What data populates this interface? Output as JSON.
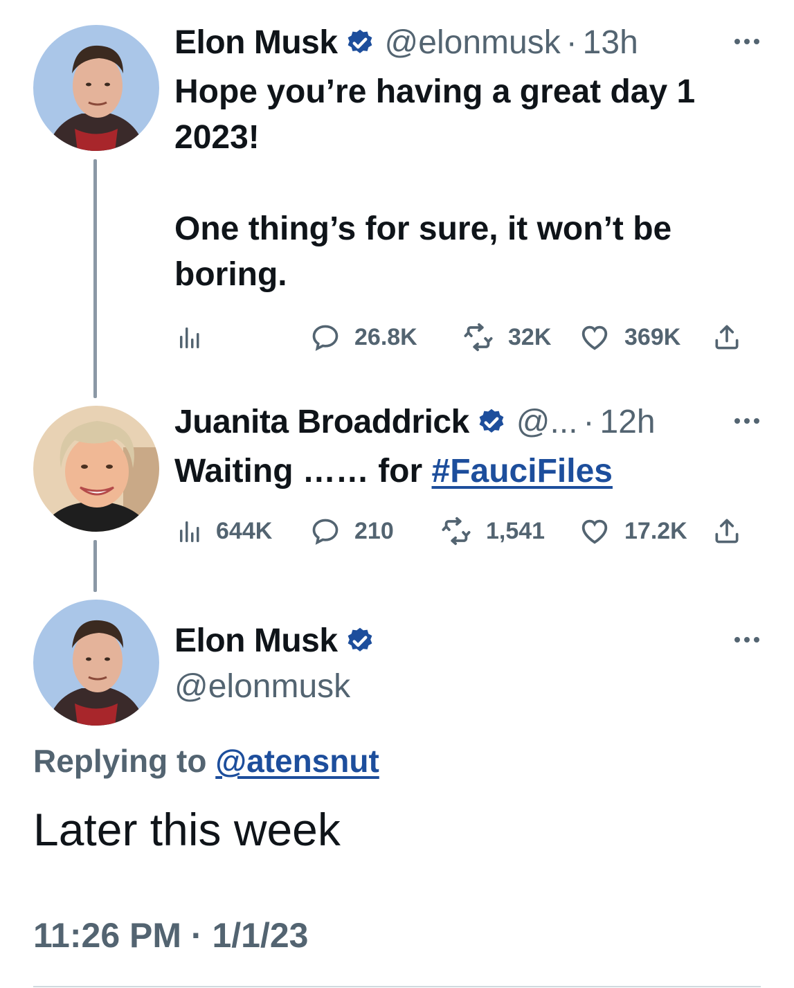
{
  "tweets": [
    {
      "name": "Elon Musk",
      "handle": "@elonmusk",
      "separator": "·",
      "time": "13h",
      "text": "Hope you’re having a great day 1\n2023!\n\nOne thing’s for sure, it won’t be\nboring.",
      "stats": {
        "views": "",
        "replies": "26.8K",
        "retweets": "32K",
        "likes": "369K"
      },
      "avatar_icon": "avatar-elon-musk"
    },
    {
      "name": "Juanita Broaddrick",
      "handle": "@...",
      "separator": "·",
      "time": "12h",
      "text_prefix": "Waiting …… for ",
      "hashtag": "#FauciFiles",
      "stats": {
        "views": "644K",
        "replies": "210",
        "retweets": "1,541",
        "likes": "17.2K"
      },
      "avatar_icon": "avatar-juanita-broaddrick"
    }
  ],
  "main_tweet": {
    "name": "Elon Musk",
    "handle": "@elonmusk",
    "replying_label": "Replying to ",
    "replying_to": "@atensnut",
    "text": "Later this week",
    "timestamp": "11:26 PM · 1/1/23"
  },
  "colors": {
    "verified": "#1d4e9c",
    "link": "#1d4e9c",
    "secondary_text": "#536471",
    "thread_line": "#8b98a5"
  },
  "icons": [
    "verified-badge-icon",
    "more-icon",
    "views-icon",
    "reply-icon",
    "retweet-icon",
    "like-icon",
    "share-icon"
  ]
}
